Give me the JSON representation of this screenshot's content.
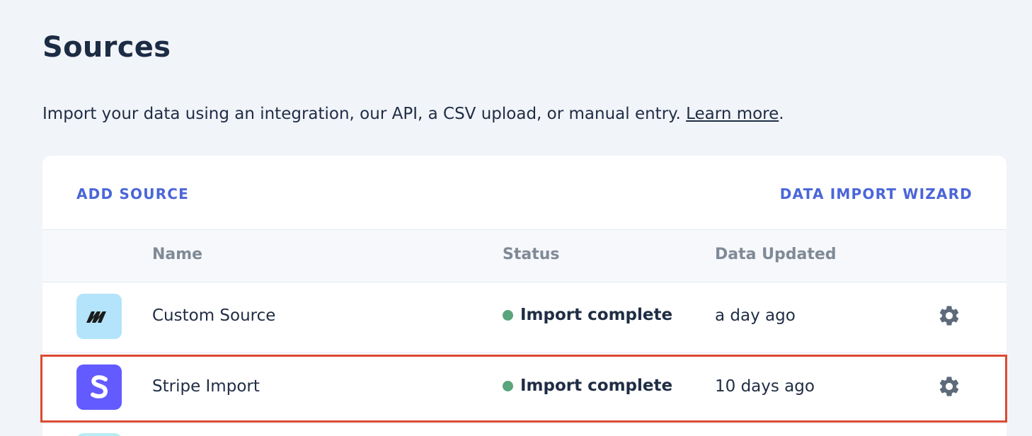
{
  "page": {
    "title": "Sources",
    "description": "Import your data using an integration, our API, a CSV upload, or manual entry.",
    "learn_more": "Learn more",
    "period": "."
  },
  "toolbar": {
    "add_source": "ADD SOURCE",
    "wizard": "DATA IMPORT WIZARD"
  },
  "table": {
    "headers": {
      "name": "Name",
      "status": "Status",
      "updated": "Data Updated"
    },
    "rows": [
      {
        "logo": "custom-source-logo-icon",
        "logo_color": "#b3e4fb",
        "name": "Custom Source",
        "status": "Import complete",
        "status_color": "#5aa57c",
        "updated": "a day ago",
        "action": "gear-icon"
      },
      {
        "logo": "stripe-logo-icon",
        "logo_color": "#635bff",
        "logo_letter": "S",
        "name": "Stripe Import",
        "status": "Import complete",
        "status_color": "#5aa57c",
        "updated": "10 days ago",
        "action": "gear-icon"
      }
    ]
  },
  "colors": {
    "accent": "#4a66d8",
    "highlight_border": "#dc4a32",
    "background": "#f1f4f9"
  }
}
